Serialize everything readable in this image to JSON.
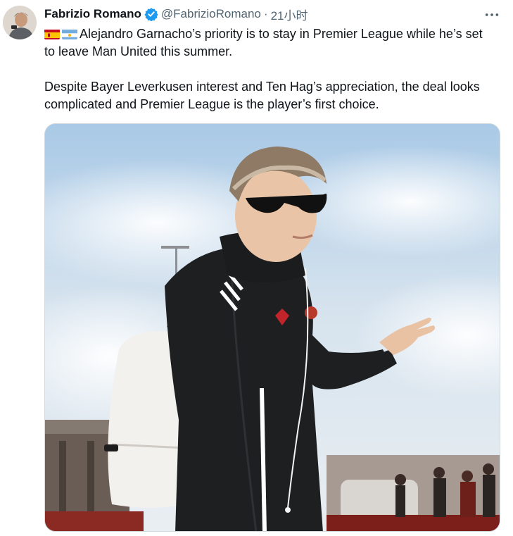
{
  "tweet": {
    "author": {
      "name": "Fabrizio Romano",
      "handle": "@FabrizioRomano",
      "verified": true,
      "avatar": "avatar"
    },
    "separator": "·",
    "timestamp": "21小时",
    "more_icon": "more-horizontal-icon",
    "flags": [
      "spain-flag",
      "argentina-flag"
    ],
    "paragraphs": [
      "Alejandro Garnacho’s priority is to stay in Premier League while he’s set to leave Man United this summer.",
      "Despite Bayer Leverkusen interest and Ten Hag’s appreciation, the deal looks complicated and Premier League is the player’s first choice."
    ],
    "media": {
      "type": "photo"
    }
  },
  "colors": {
    "text": "#0f1419",
    "secondary": "#536471",
    "verified": "#1d9bf0",
    "border": "#cfd9de"
  }
}
